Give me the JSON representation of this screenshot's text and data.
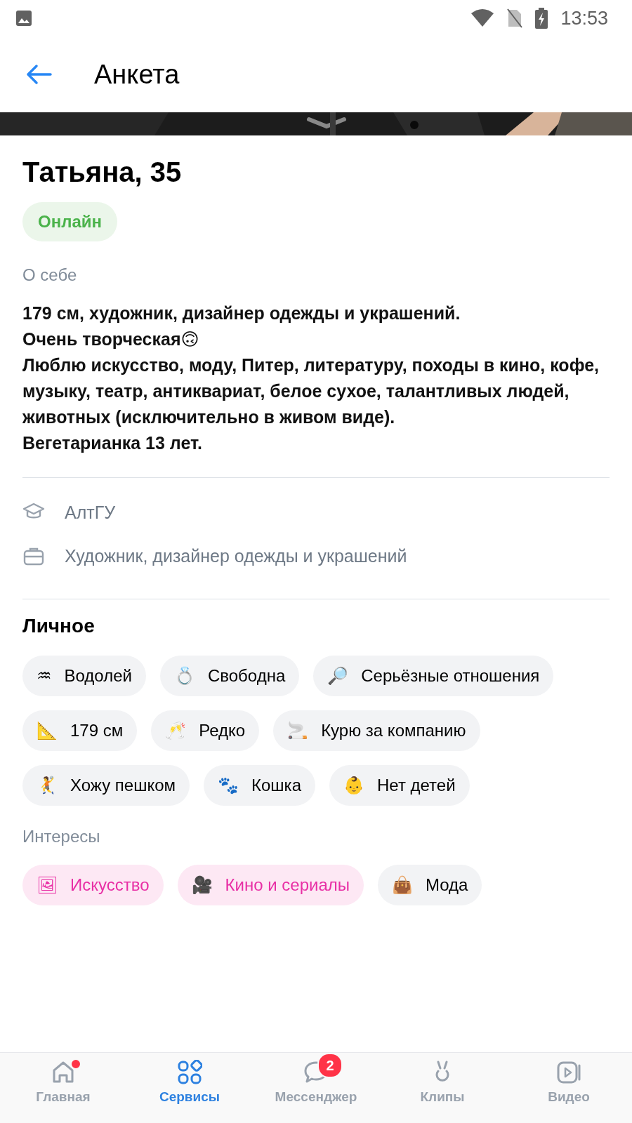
{
  "status_bar": {
    "time": "13:53"
  },
  "header": {
    "title": "Анкета"
  },
  "profile": {
    "name": "Татьяна, 35",
    "status": "Онлайн"
  },
  "about": {
    "label": "О себе",
    "text": "179 см, художник, дизайнер одежды и украшений.\nОчень творческая🙃\nЛюблю искусство, моду, Питер, литературу, походы в кино, кофе, музыку, театр, антиквариат, белое сухое, талантливых людей, животных (исключительно в живом виде).\nВегетарианка 13 лет."
  },
  "info": [
    {
      "kind": "education",
      "text": "АлтГУ"
    },
    {
      "kind": "work",
      "text": "Художник, дизайнер одежды и украшений"
    }
  ],
  "personal": {
    "title": "Личное",
    "chips": [
      {
        "icon": "♒",
        "text": "Водолей"
      },
      {
        "icon": "💍",
        "text": "Свободна"
      },
      {
        "icon": "🔎",
        "text": "Серьёзные отношения"
      },
      {
        "icon": "📐",
        "text": "179 см"
      },
      {
        "icon": "🥂",
        "text": "Редко"
      },
      {
        "icon": "🚬",
        "text": "Курю за компанию"
      },
      {
        "icon": "🤾",
        "text": "Хожу пешком"
      },
      {
        "icon": "🐾",
        "text": "Кошка"
      },
      {
        "icon": "👶",
        "text": "Нет детей"
      }
    ]
  },
  "interests": {
    "label": "Интересы",
    "chips": [
      {
        "icon": "🖼",
        "text": "Искусство",
        "selected": true
      },
      {
        "icon": "🎥",
        "text": "Кино и сериалы",
        "selected": true
      },
      {
        "icon": "👜",
        "text": "Мода",
        "selected": false
      }
    ]
  },
  "nav": [
    {
      "kind": "home",
      "label": "Главная",
      "selected": false,
      "dot": true
    },
    {
      "kind": "services",
      "label": "Сервисы",
      "selected": true,
      "dot": false
    },
    {
      "kind": "messenger",
      "label": "Мессенджер",
      "selected": false,
      "dot": false,
      "badge": "2"
    },
    {
      "kind": "clips",
      "label": "Клипы",
      "selected": false,
      "dot": false
    },
    {
      "kind": "video",
      "label": "Видео",
      "selected": false,
      "dot": false
    }
  ]
}
